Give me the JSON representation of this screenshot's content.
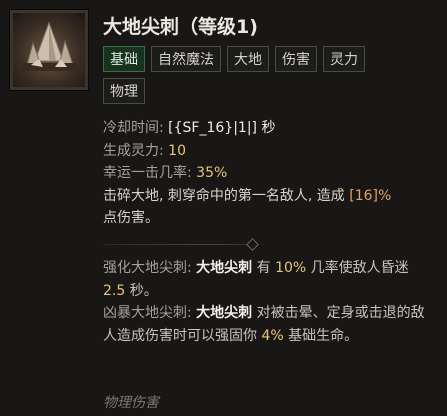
{
  "skill": {
    "title": "大地尖刺（等级1)",
    "icon": "earthspike-icon"
  },
  "tags": [
    "基础",
    "自然魔法",
    "大地",
    "伤害",
    "灵力",
    "物理"
  ],
  "stats": {
    "cooldown_label": "冷却时间:",
    "cooldown_value": "[{SF_16}|1|]",
    "cooldown_unit": "秒",
    "spirit_label": "生成灵力:",
    "spirit_value": "10",
    "lucky_label": "幸运一击几率:",
    "lucky_value": "35%"
  },
  "description": {
    "part1": "击碎大地, 刺穿命中的第一名敌人, 造成",
    "damage": "[16]%",
    "part2": "点伤害。"
  },
  "enchant1": {
    "label": "强化大地尖刺:",
    "skill": "大地尖刺",
    "t1": "有",
    "chance": "10%",
    "t2": "几率使敌人昏迷",
    "duration": "2.5",
    "t3": "秒。"
  },
  "enchant2": {
    "label": "凶暴大地尖刺:",
    "skill": "大地尖刺",
    "t1": "对被击晕、定身或击退的敌人造成伤害时可以强固你",
    "percent": "4%",
    "t2": "基础生命。"
  },
  "footer": "物理伤害"
}
